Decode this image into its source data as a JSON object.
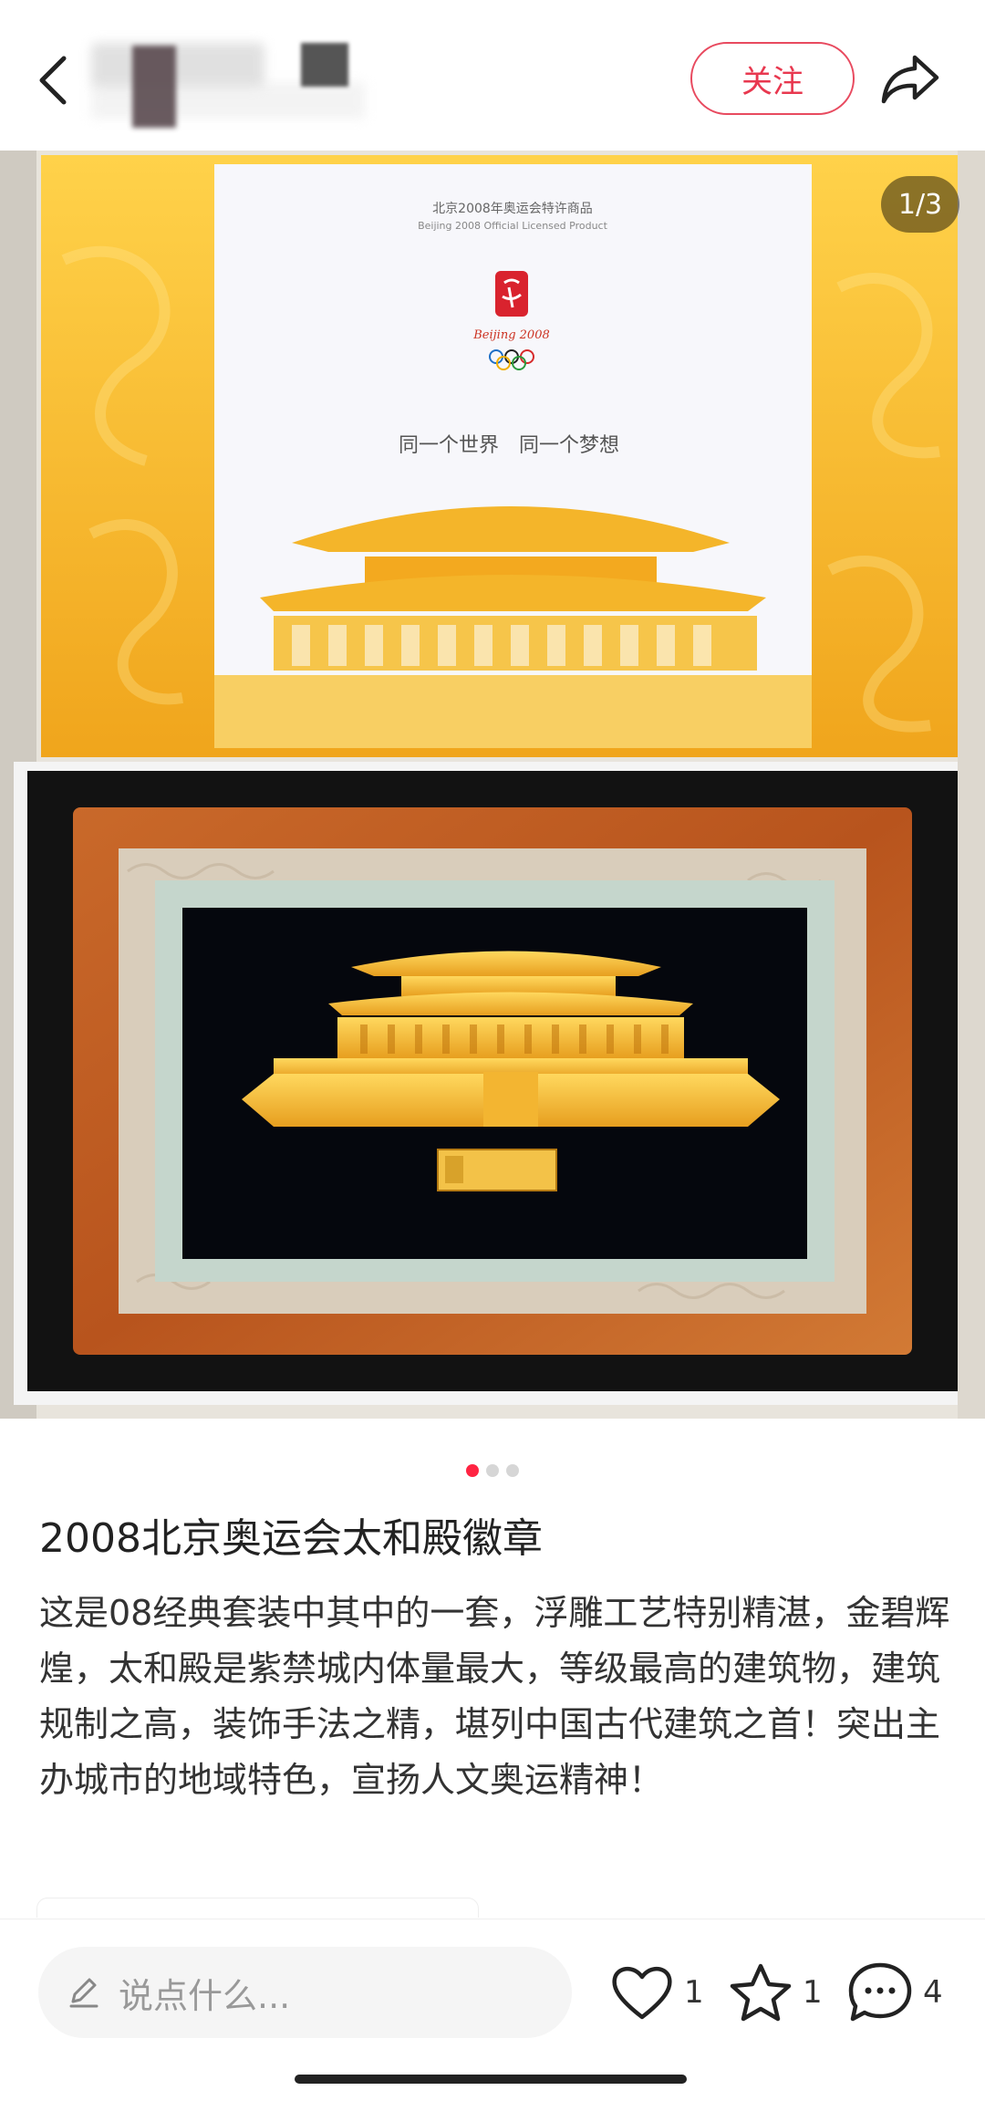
{
  "header": {
    "follow_label": "关注"
  },
  "photo": {
    "counter": "1/3",
    "box_top_line1": "北京2008年奥运会特许商品",
    "box_top_line2": "Beijing 2008 Official Licensed Product",
    "logo_text": "Beijing 2008",
    "slogan": "同一个世界　同一个梦想"
  },
  "post": {
    "title": "2008北京奥运会太和殿徽章",
    "description": "这是08经典套装中其中的一套，浮雕工艺特别精湛，金碧辉煌，太和殿是紫禁城内体量最大，等级最高的建筑物，建筑规制之高，装饰手法之精，堪列中国古代建筑之首！突出主办城市的地域特色，宣扬人文奥运精神！"
  },
  "bottombar": {
    "comment_placeholder": "说点什么...",
    "likes": "1",
    "collects": "1",
    "comments": "4"
  },
  "colors": {
    "accent": "#ff2442",
    "gold": "#f2b52c"
  }
}
